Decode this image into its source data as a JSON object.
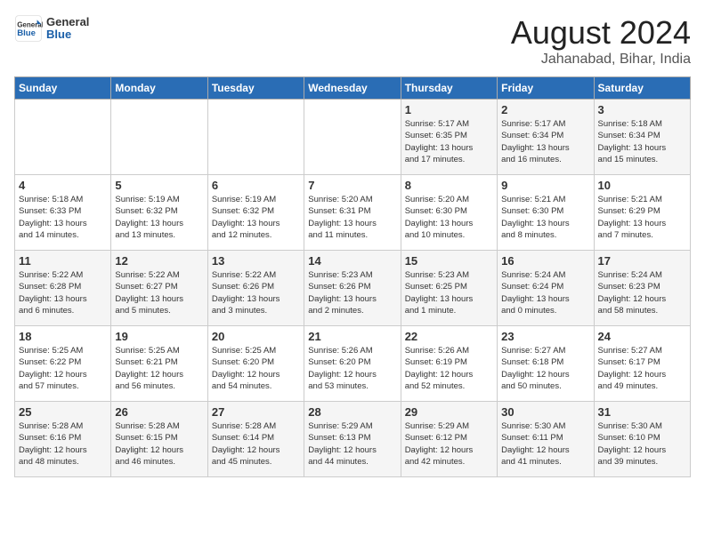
{
  "logo": {
    "text_general": "General",
    "text_blue": "Blue"
  },
  "calendar": {
    "title": "August 2024",
    "subtitle": "Jahanabad, Bihar, India"
  },
  "headers": [
    "Sunday",
    "Monday",
    "Tuesday",
    "Wednesday",
    "Thursday",
    "Friday",
    "Saturday"
  ],
  "weeks": [
    [
      {
        "day": "",
        "info": ""
      },
      {
        "day": "",
        "info": ""
      },
      {
        "day": "",
        "info": ""
      },
      {
        "day": "",
        "info": ""
      },
      {
        "day": "1",
        "info": "Sunrise: 5:17 AM\nSunset: 6:35 PM\nDaylight: 13 hours\nand 17 minutes."
      },
      {
        "day": "2",
        "info": "Sunrise: 5:17 AM\nSunset: 6:34 PM\nDaylight: 13 hours\nand 16 minutes."
      },
      {
        "day": "3",
        "info": "Sunrise: 5:18 AM\nSunset: 6:34 PM\nDaylight: 13 hours\nand 15 minutes."
      }
    ],
    [
      {
        "day": "4",
        "info": "Sunrise: 5:18 AM\nSunset: 6:33 PM\nDaylight: 13 hours\nand 14 minutes."
      },
      {
        "day": "5",
        "info": "Sunrise: 5:19 AM\nSunset: 6:32 PM\nDaylight: 13 hours\nand 13 minutes."
      },
      {
        "day": "6",
        "info": "Sunrise: 5:19 AM\nSunset: 6:32 PM\nDaylight: 13 hours\nand 12 minutes."
      },
      {
        "day": "7",
        "info": "Sunrise: 5:20 AM\nSunset: 6:31 PM\nDaylight: 13 hours\nand 11 minutes."
      },
      {
        "day": "8",
        "info": "Sunrise: 5:20 AM\nSunset: 6:30 PM\nDaylight: 13 hours\nand 10 minutes."
      },
      {
        "day": "9",
        "info": "Sunrise: 5:21 AM\nSunset: 6:30 PM\nDaylight: 13 hours\nand 8 minutes."
      },
      {
        "day": "10",
        "info": "Sunrise: 5:21 AM\nSunset: 6:29 PM\nDaylight: 13 hours\nand 7 minutes."
      }
    ],
    [
      {
        "day": "11",
        "info": "Sunrise: 5:22 AM\nSunset: 6:28 PM\nDaylight: 13 hours\nand 6 minutes."
      },
      {
        "day": "12",
        "info": "Sunrise: 5:22 AM\nSunset: 6:27 PM\nDaylight: 13 hours\nand 5 minutes."
      },
      {
        "day": "13",
        "info": "Sunrise: 5:22 AM\nSunset: 6:26 PM\nDaylight: 13 hours\nand 3 minutes."
      },
      {
        "day": "14",
        "info": "Sunrise: 5:23 AM\nSunset: 6:26 PM\nDaylight: 13 hours\nand 2 minutes."
      },
      {
        "day": "15",
        "info": "Sunrise: 5:23 AM\nSunset: 6:25 PM\nDaylight: 13 hours\nand 1 minute."
      },
      {
        "day": "16",
        "info": "Sunrise: 5:24 AM\nSunset: 6:24 PM\nDaylight: 13 hours\nand 0 minutes."
      },
      {
        "day": "17",
        "info": "Sunrise: 5:24 AM\nSunset: 6:23 PM\nDaylight: 12 hours\nand 58 minutes."
      }
    ],
    [
      {
        "day": "18",
        "info": "Sunrise: 5:25 AM\nSunset: 6:22 PM\nDaylight: 12 hours\nand 57 minutes."
      },
      {
        "day": "19",
        "info": "Sunrise: 5:25 AM\nSunset: 6:21 PM\nDaylight: 12 hours\nand 56 minutes."
      },
      {
        "day": "20",
        "info": "Sunrise: 5:25 AM\nSunset: 6:20 PM\nDaylight: 12 hours\nand 54 minutes."
      },
      {
        "day": "21",
        "info": "Sunrise: 5:26 AM\nSunset: 6:20 PM\nDaylight: 12 hours\nand 53 minutes."
      },
      {
        "day": "22",
        "info": "Sunrise: 5:26 AM\nSunset: 6:19 PM\nDaylight: 12 hours\nand 52 minutes."
      },
      {
        "day": "23",
        "info": "Sunrise: 5:27 AM\nSunset: 6:18 PM\nDaylight: 12 hours\nand 50 minutes."
      },
      {
        "day": "24",
        "info": "Sunrise: 5:27 AM\nSunset: 6:17 PM\nDaylight: 12 hours\nand 49 minutes."
      }
    ],
    [
      {
        "day": "25",
        "info": "Sunrise: 5:28 AM\nSunset: 6:16 PM\nDaylight: 12 hours\nand 48 minutes."
      },
      {
        "day": "26",
        "info": "Sunrise: 5:28 AM\nSunset: 6:15 PM\nDaylight: 12 hours\nand 46 minutes."
      },
      {
        "day": "27",
        "info": "Sunrise: 5:28 AM\nSunset: 6:14 PM\nDaylight: 12 hours\nand 45 minutes."
      },
      {
        "day": "28",
        "info": "Sunrise: 5:29 AM\nSunset: 6:13 PM\nDaylight: 12 hours\nand 44 minutes."
      },
      {
        "day": "29",
        "info": "Sunrise: 5:29 AM\nSunset: 6:12 PM\nDaylight: 12 hours\nand 42 minutes."
      },
      {
        "day": "30",
        "info": "Sunrise: 5:30 AM\nSunset: 6:11 PM\nDaylight: 12 hours\nand 41 minutes."
      },
      {
        "day": "31",
        "info": "Sunrise: 5:30 AM\nSunset: 6:10 PM\nDaylight: 12 hours\nand 39 minutes."
      }
    ]
  ]
}
